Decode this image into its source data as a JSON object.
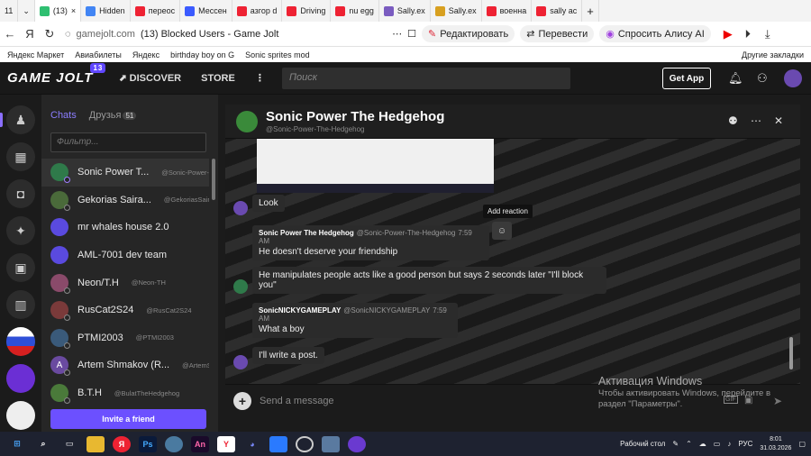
{
  "browser": {
    "tabs": [
      {
        "label": "11",
        "icon": "tab-count"
      },
      {
        "label": "(13)",
        "icon": "gamejolt-icon"
      },
      {
        "label": "Hidden",
        "icon": "google-icon"
      },
      {
        "label": "переос",
        "icon": "yandex-icon"
      },
      {
        "label": "Мессен",
        "icon": "messenger-icon"
      },
      {
        "label": "азгор d",
        "icon": "yandex-icon"
      },
      {
        "label": "Driving",
        "icon": "yandex-icon"
      },
      {
        "label": "nu egg",
        "icon": "yandex-icon"
      },
      {
        "label": "Sally.ex",
        "icon": "wiki-icon"
      },
      {
        "label": "Sally.ex",
        "icon": "wiki-icon"
      },
      {
        "label": "военна",
        "icon": "yandex-icon"
      },
      {
        "label": "sally ac",
        "icon": "yandex-icon"
      }
    ],
    "address": {
      "domain": "gamejolt.com",
      "page_title": "(13) Blocked Users - Game Jolt"
    },
    "actions": {
      "edit": "Редактировать",
      "translate": "Перевести",
      "ask": "Спросить Алису AI"
    },
    "bookmarks": [
      "Яндекс Маркет",
      "Авиабилеты",
      "Яндекс",
      "birthday boy on G",
      "Sonic sprites mod"
    ],
    "other_bookmarks": "Другие закладки"
  },
  "topnav": {
    "logo": "GAME JOLT",
    "badge": "13",
    "discover": "DISCOVER",
    "store": "STORE",
    "search_placeholder": "Поиск",
    "get_app": "Get App"
  },
  "chatlist": {
    "tab_chats": "Chats",
    "tab_friends": "Друзья",
    "friends_count": "51",
    "filter_placeholder": "Фильтр...",
    "items": [
      {
        "name": "Sonic Power T...",
        "user": "@Sonic-Power-...",
        "color": "#2f7a4a"
      },
      {
        "name": "Gekorias Saira...",
        "user": "@GekoriasSaira...",
        "color": "#4a6a3a"
      },
      {
        "name": "mr whales house 2.0",
        "user": "",
        "color": "#5a4adf"
      },
      {
        "name": "AML-7001 dev team",
        "user": "",
        "color": "#5a4adf"
      },
      {
        "name": "Neon/T.H",
        "user": "@Neon-TH",
        "color": "#8a4a6a"
      },
      {
        "name": "RusCat2S24",
        "user": "@RusCat2S24",
        "color": "#7a3a3a"
      },
      {
        "name": "PTMI2003",
        "user": "@PTMI2003",
        "color": "#3a5a7a"
      },
      {
        "name": "Artem Shmakov (R...",
        "user": "@ArtemS...",
        "color": "#6a4aa0"
      },
      {
        "name": "B.T.H",
        "user": "@BulatTheHedgehog",
        "color": "#4a7a3a"
      }
    ],
    "invite": "Invite a friend"
  },
  "chat": {
    "title": "Sonic Power The Hedgehog",
    "username": "@Sonic-Power-The-Hedgehog",
    "messages": [
      {
        "text": "Look"
      },
      {
        "author": "Sonic Power The Hedgehog",
        "handle": "@Sonic-Power-The-Hedgehog",
        "time": "7:59 AM",
        "text": "He doesn't deserve your friendship"
      },
      {
        "text": "He manipulates people acts like a good person but says 2 seconds later \"I'll block you\""
      },
      {
        "author": "SonicNICKYGAMEPLAY",
        "handle": "@SonicNICKYGAMEPLAY",
        "time": "7:59 AM",
        "text": "What a boy"
      },
      {
        "text": "I'll write a post."
      }
    ],
    "tooltip": "Add reaction",
    "composer_placeholder": "Send a message"
  },
  "watermark": {
    "title": "Активация Windows",
    "line1": "Чтобы активировать Windows, перейдите в",
    "line2": "раздел \"Параметры\"."
  },
  "taskbar": {
    "desktop": "Рабочий стол",
    "lang": "РУС",
    "time": "8:01",
    "date": "31.03.2026"
  }
}
